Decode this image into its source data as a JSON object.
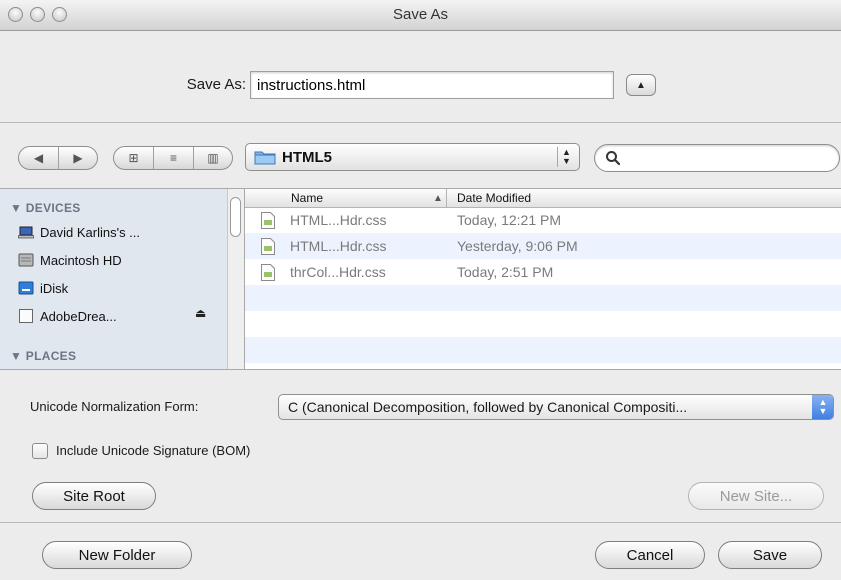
{
  "window": {
    "title": "Save As"
  },
  "save_as": {
    "label": "Save As:",
    "filename": "instructions.html",
    "expand_glyph": "▲"
  },
  "toolbar": {
    "nav": [
      "◀",
      "▶"
    ],
    "views": [
      "⊞",
      "≡",
      "▥"
    ],
    "current_folder": "HTML5",
    "search_placeholder": ""
  },
  "sidebar": {
    "devices_header": "▼ DEVICES",
    "places_header": "▼ PLACES",
    "items": [
      {
        "label": "David Karlins's ...",
        "icon": "laptop-icon"
      },
      {
        "label": "Macintosh HD",
        "icon": "hard-drive-icon"
      },
      {
        "label": "iDisk",
        "icon": "idisk-icon"
      },
      {
        "label": "AdobeDrea...",
        "icon": "document-icon",
        "eject": "⏏"
      }
    ]
  },
  "file_list": {
    "columns": {
      "name": "Name",
      "sort": "▲",
      "date": "Date Modified"
    },
    "rows": [
      {
        "name": "HTML...Hdr.css",
        "date": "Today, 12:21 PM"
      },
      {
        "name": "HTML...Hdr.css",
        "date": "Yesterday, 9:06 PM"
      },
      {
        "name": "thrCol...Hdr.css",
        "date": "Today, 2:51 PM"
      }
    ]
  },
  "options": {
    "normalization_label": "Unicode Normalization Form:",
    "normalization_value": "C (Canonical Decomposition, followed by Canonical Compositi...",
    "bom_label": "Include Unicode Signature (BOM)",
    "bom_checked": false
  },
  "buttons": {
    "site_root": "Site Root",
    "new_site": "New Site...",
    "new_folder": "New Folder",
    "cancel": "Cancel",
    "save": "Save"
  }
}
